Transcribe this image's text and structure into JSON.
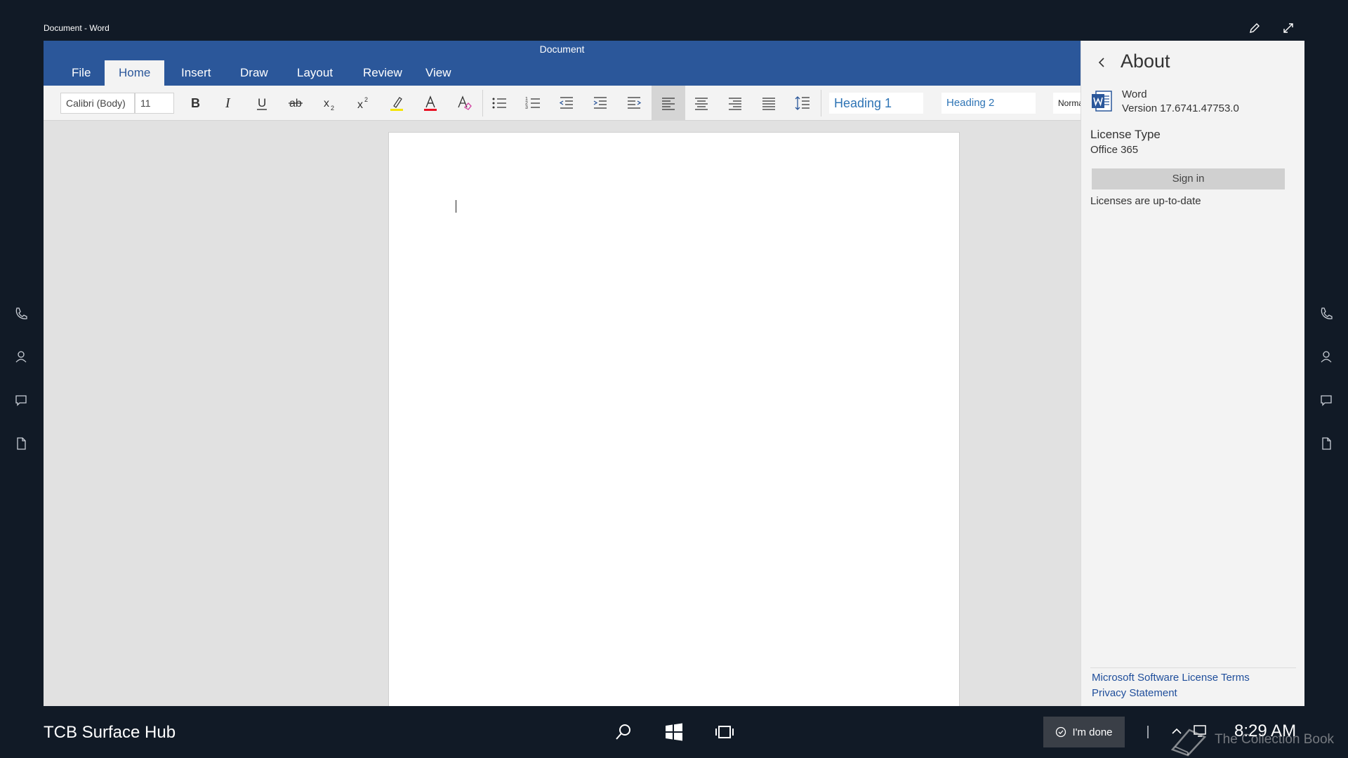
{
  "window": {
    "title": "Document - Word"
  },
  "ribbon": {
    "doc_title": "Document",
    "tabs": [
      {
        "label": "File"
      },
      {
        "label": "Home"
      },
      {
        "label": "Insert"
      },
      {
        "label": "Draw"
      },
      {
        "label": "Layout"
      },
      {
        "label": "Review"
      },
      {
        "label": "View"
      }
    ],
    "active_tab": "Home",
    "font_name": "Calibri (Body)",
    "font_size": "11",
    "styles": [
      {
        "label": "Heading 1"
      },
      {
        "label": "Heading 2"
      },
      {
        "label": "Normal"
      }
    ]
  },
  "about": {
    "title": "About",
    "app_name": "Word",
    "version": "Version 17.6741.47753.0",
    "license_type_label": "License Type",
    "license_type_value": "Office 365",
    "sign_in_label": "Sign in",
    "license_status": "Licenses are up-to-date",
    "links": [
      {
        "label": "Microsoft Software License Terms"
      },
      {
        "label": "Privacy Statement"
      }
    ]
  },
  "taskbar": {
    "device_name": "TCB Surface Hub",
    "done_label": "I'm done",
    "clock": "8:29 AM",
    "watermark": "The Collection Book"
  },
  "colors": {
    "ribbon_blue": "#2b579a",
    "background": "#111a26",
    "link": "#1f4e9b",
    "font_color_bar": "#e81123",
    "highlight_bar": "#f5e400"
  }
}
